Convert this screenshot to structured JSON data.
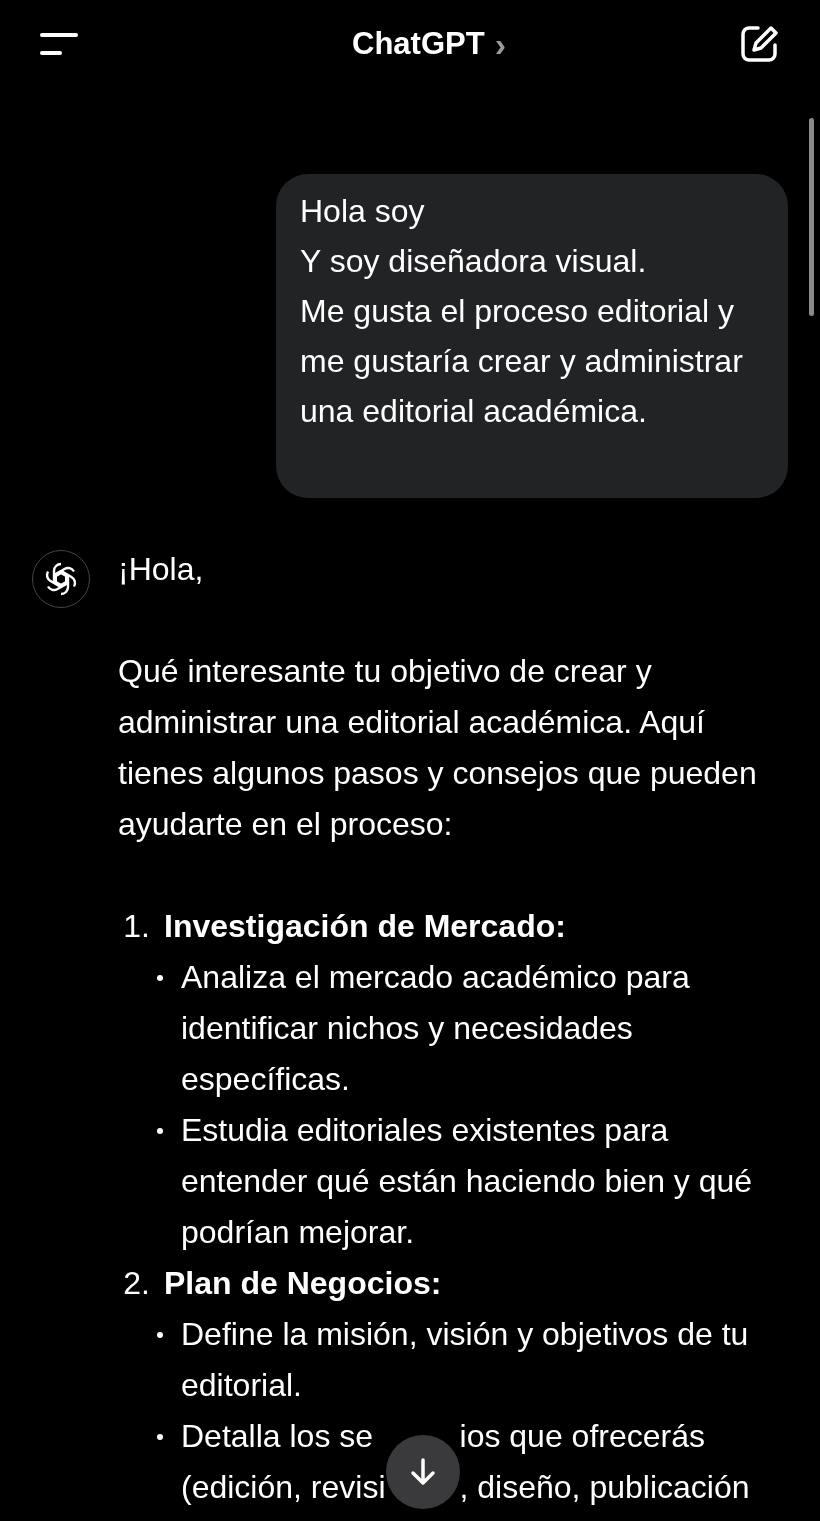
{
  "header": {
    "title": "ChatGPT",
    "chevron": "›"
  },
  "user_message": {
    "lines": [
      "Hola soy",
      "Y soy diseñadora visual.",
      "Me gusta el proceso editorial y me gustaría crear y administrar una editorial académica."
    ]
  },
  "assistant_message": {
    "greeting": "¡Hola,",
    "intro": "Qué interesante tu objetivo de crear y administrar una editorial académica. Aquí tienes algunos pasos y consejos que pueden ayudarte en el proceso:",
    "steps": [
      {
        "number": "1.",
        "title": "Investigación de Mercado:",
        "bullets": [
          {
            "kind": "text",
            "text": "Analiza el mercado académico para identificar nichos y necesidades específicas."
          },
          {
            "kind": "text",
            "text": "Estudia editoriales existentes para entender qué están haciendo bien y qué podrían mejorar."
          }
        ]
      },
      {
        "number": "2.",
        "title": "Plan de Negocios:",
        "bullets": [
          {
            "kind": "text",
            "text": "Define la misión, visión y objetivos de tu editorial."
          },
          {
            "kind": "covered",
            "lines": [
              [
                "Detalla los se",
                "ios que ofrecerás"
              ],
              [
                "(edición, revisi",
                ", diseño, publicación"
              ]
            ]
          }
        ]
      }
    ]
  }
}
